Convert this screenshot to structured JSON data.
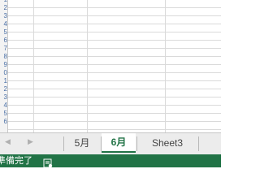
{
  "grid": {
    "row_numbers": [
      "1",
      "2",
      "3",
      "4",
      "5",
      "6",
      "7",
      "8",
      "9",
      "0",
      "1",
      "2",
      "3",
      "4",
      "5",
      "6"
    ]
  },
  "sheet_tabs": {
    "nav_prev": "◀",
    "nav_next": "▶",
    "tabs": [
      {
        "label": "5月",
        "active": false
      },
      {
        "label": "6月",
        "active": true
      },
      {
        "label": "Sheet3",
        "active": false
      }
    ]
  },
  "status_bar": {
    "status_text": "準備完了",
    "icon": "macro-record-icon"
  },
  "colors": {
    "accent": "#217346",
    "gridline": "#dadada",
    "tabbar_bg": "#ececec"
  }
}
